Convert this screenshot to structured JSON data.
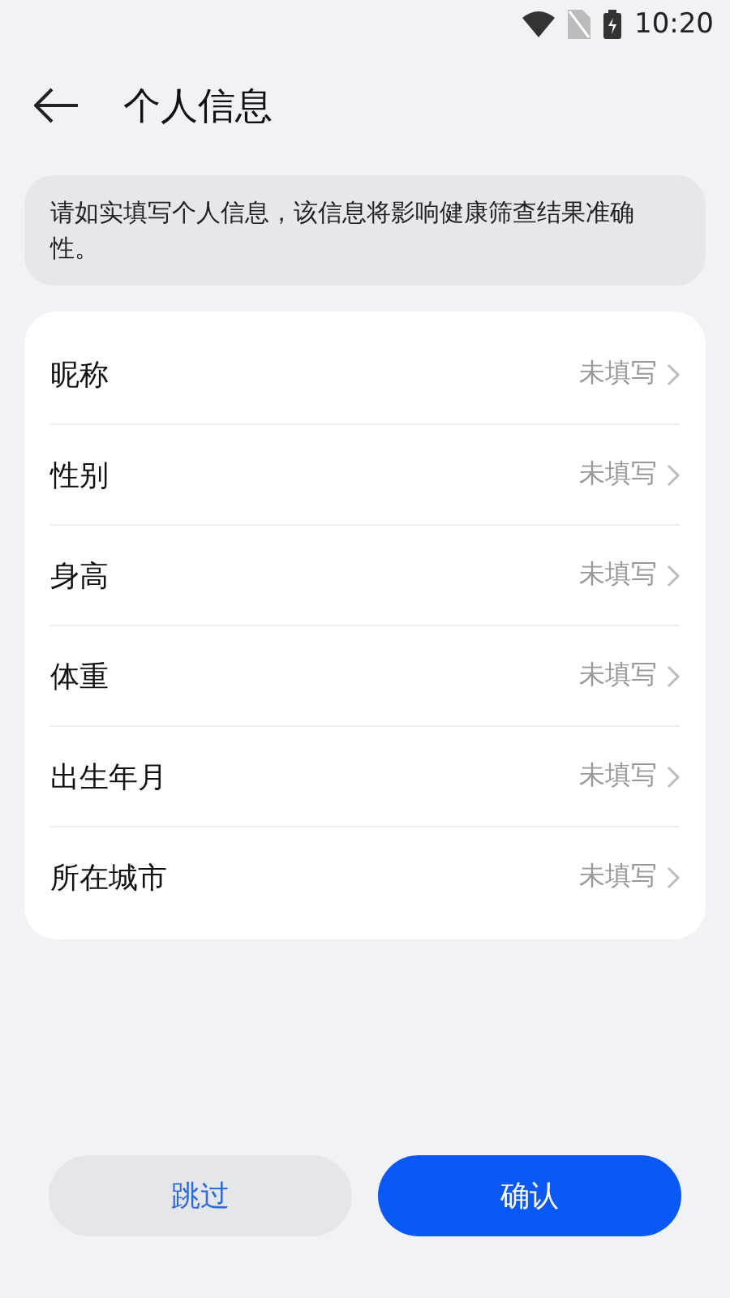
{
  "status_bar": {
    "time": "10:20"
  },
  "header": {
    "title": "个人信息"
  },
  "notice": "请如实填写个人信息，该信息将影响健康筛查结果准确性。",
  "fields": [
    {
      "label": "昵称",
      "value": "未填写"
    },
    {
      "label": "性别",
      "value": "未填写"
    },
    {
      "label": "身高",
      "value": "未填写"
    },
    {
      "label": "体重",
      "value": "未填写"
    },
    {
      "label": "出生年月",
      "value": "未填写"
    },
    {
      "label": "所在城市",
      "value": "未填写"
    }
  ],
  "buttons": [
    {
      "label": "跳过",
      "kind": "secondary"
    },
    {
      "label": "确认",
      "kind": "primary"
    }
  ]
}
